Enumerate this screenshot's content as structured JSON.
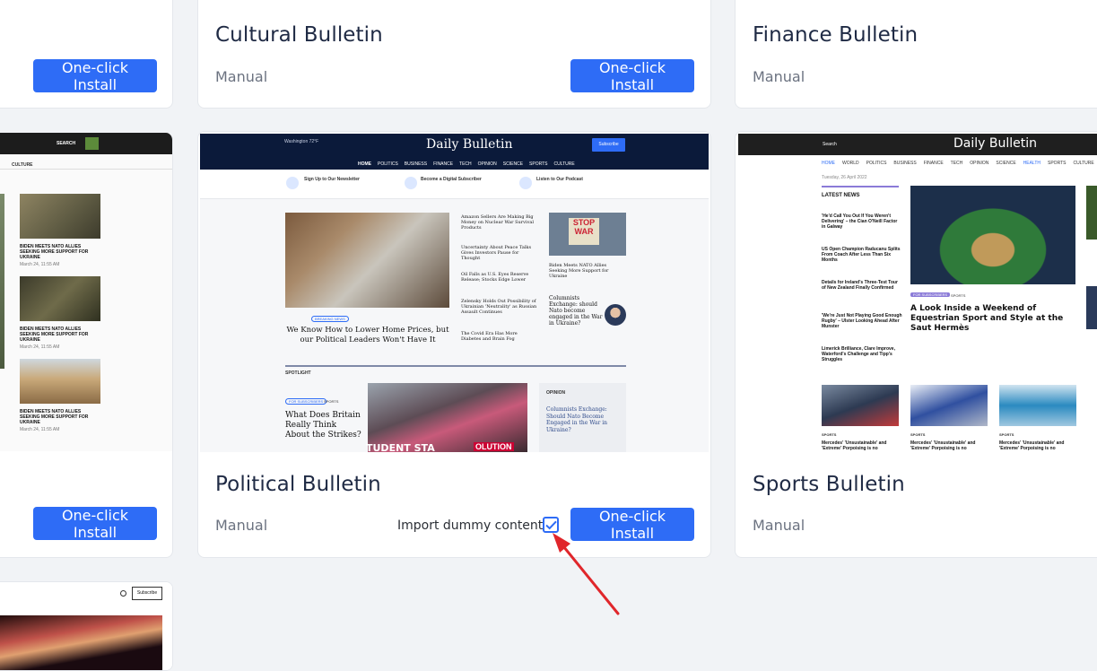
{
  "cards": {
    "cultural": {
      "title": "Cultural Bulletin",
      "type": "Manual",
      "button": "One-click Install"
    },
    "finance": {
      "title": "Finance Bulletin",
      "type": "Manual"
    },
    "left_top": {
      "button": "One-click Install"
    },
    "left_mid": {
      "button": "One-click Install"
    },
    "political": {
      "title": "Political Bulletin",
      "type": "Manual",
      "import_label": "Import dummy content?",
      "import_checked": true,
      "button": "One-click Install"
    },
    "sports": {
      "title": "Sports Bulletin",
      "type": "Manual"
    }
  },
  "previews": {
    "left": {
      "search": "SEARCH",
      "nav": "CULTURE",
      "items": [
        {
          "headline": "BIDEN MEETS NATO ALLIES SEEKING MORE SUPPORT FOR UKRAINE",
          "date": "March 24, 11:55 AM"
        },
        {
          "headline": "BIDEN MEETS NATO ALLIES SEEKING MORE SUPPORT FOR UKRAINE",
          "date": "March 24, 11:55 AM"
        },
        {
          "headline": "BIDEN MEETS NATO ALLIES SEEKING MORE SUPPORT FOR UKRAINE",
          "date": "March 24, 11:55 AM"
        }
      ]
    },
    "political": {
      "weather": "Washington 72°F",
      "logo": "Daily Bulletin",
      "subscribe": "Subscribe",
      "nav": [
        "HOME",
        "POLITICS",
        "BUSINESS",
        "FINANCE",
        "TECH",
        "OPINION",
        "SCIENCE",
        "SPORTS",
        "CULTURE"
      ],
      "promos": [
        "Sign Up to Our Newsletter",
        "Become a Digital Subscriber",
        "Listen to Our Podcast"
      ],
      "lead_badge": "BREAKING NEWS",
      "lead_headline": "We Know How to Lower Home Prices, but our Political Leaders Won't Have It",
      "side_headlines": [
        "Amazon Sellers Are Making Big Money on Nuclear War Survival Products",
        "Uncertainty About Peace Talks Gives Investors Pause for Thought",
        "Oil Falls as U.S. Eyes Reserve Release; Stocks Edge Lower",
        "Zelensky Holds Out Possibility of Ukrainian 'Neutrality' as Russian Assault Continues",
        "The Covid Era Has More Diabetes and Brain Fog"
      ],
      "right_headline": "Biden Meets NATO Allies Seeking More Support for Ukraine",
      "columnist_headline": "Columnists Exchange: should Nato become engaged in the War in Ukraine?",
      "spotlight": "SPOTLIGHT",
      "spot_tags": [
        "FOR SUBSCRIBERS",
        "SPORTS"
      ],
      "spot_headline": "What Does Britain Really Think About the Strikes?",
      "opinion_label": "OPINION",
      "opinion_headline": "Columnists Exchange: Should Nato Become Engaged in the War in Ukraine?",
      "sign_text_1": "STOP WAR",
      "sign_text_2": "TUDENT STA",
      "sign_text_3": "OLUTION"
    },
    "sports": {
      "search": "Search",
      "logo": "Daily Bulletin",
      "nav": [
        "HOME",
        "WORLD",
        "POLITICS",
        "BUSINESS",
        "FINANCE",
        "TECH",
        "OPINION",
        "SCIENCE",
        "HEALTH",
        "SPORTS",
        "CULTURE"
      ],
      "date": "Tuesday, 26 April 2022",
      "latest": "LATEST NEWS",
      "latest_items": [
        "'He'd Call You Out If You Weren't Delivering' – the Cian O'Neill Factor in Galway",
        "US Open Champion Raducanu Splits From Coach After Less Than Six Months",
        "Details for Ireland's Three-Test Tour of New Zealand Finally Confirmed",
        "'We're Just Not Playing Good Enough Rugby' – Ulster Looking Ahead After Munster",
        "Limerick Brilliance, Clare Improve, Waterford's Challenge and Tipp's Struggles"
      ],
      "feature_tags": [
        "FOR SUBSCRIBERS",
        "SPORTS"
      ],
      "feature_headline": "A Look Inside a Weekend of Equestrian Sport and Style at the Saut Hermès",
      "bottom_tag": "SPORTS",
      "bottom_headline": "Mercedes' 'Unsustainable' and 'Extreme' Porpoising is no"
    },
    "bottom_left": {
      "subscribe": "Subscribe"
    }
  },
  "colors": {
    "accent": "#2e6cf6",
    "navy": "#0b1a3a",
    "arrow": "#e0262b"
  }
}
